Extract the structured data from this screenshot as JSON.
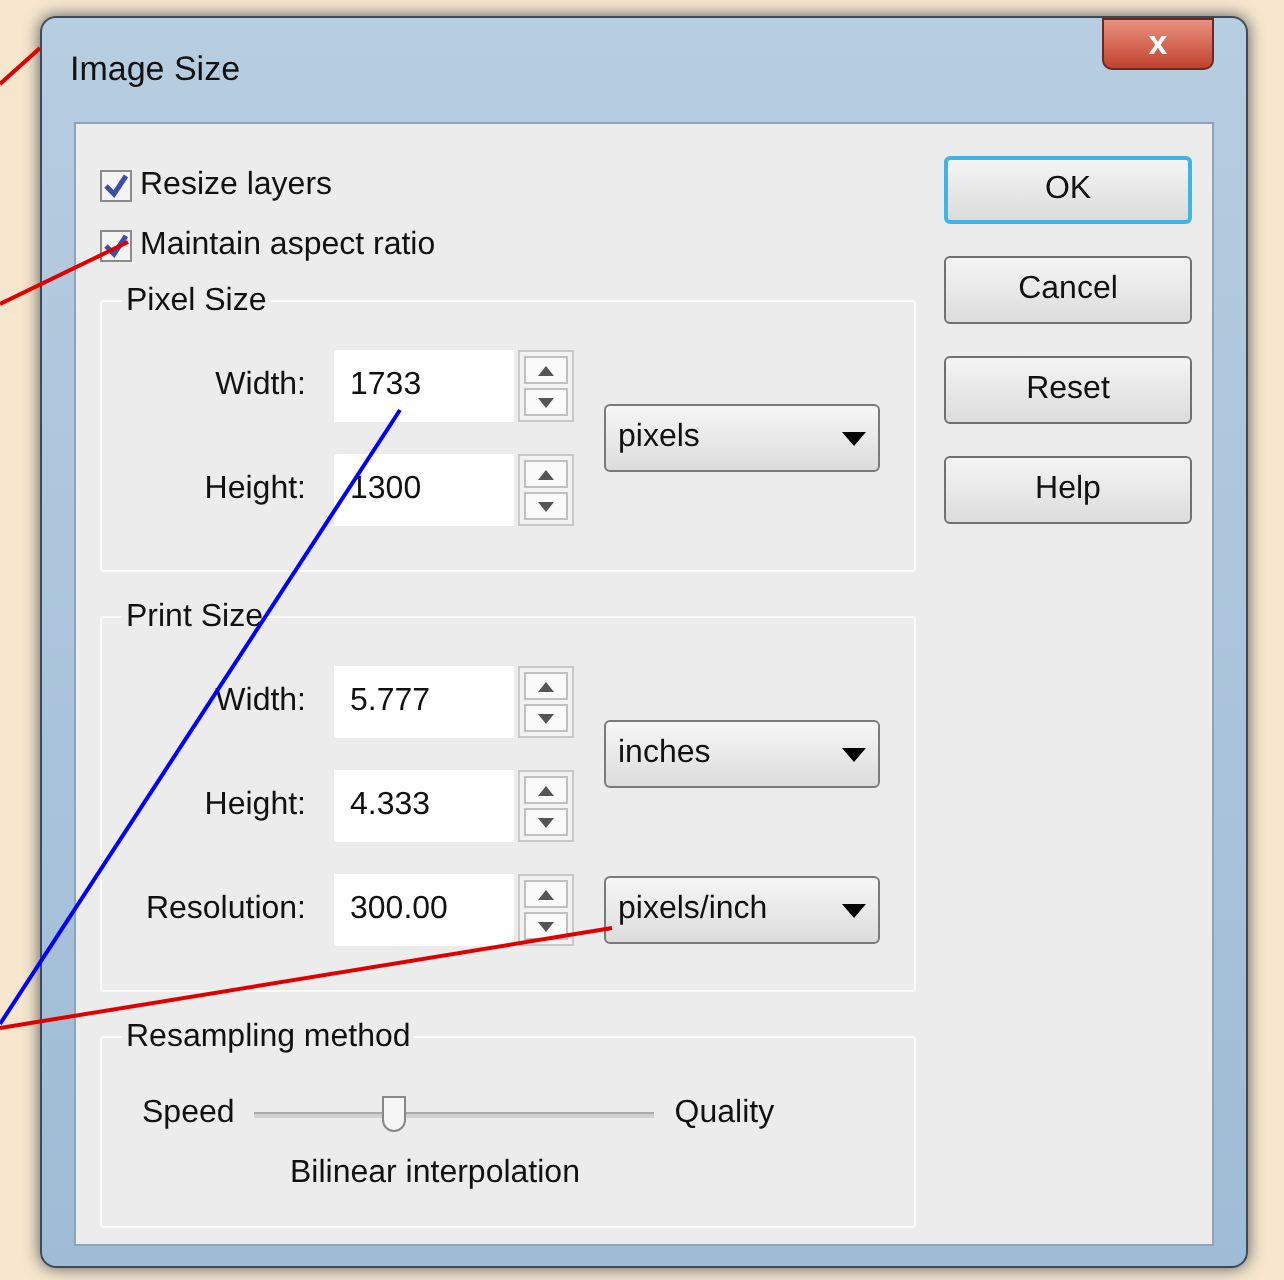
{
  "window": {
    "title": "Image Size",
    "close_label": "x"
  },
  "options": [
    {
      "label": "Resize layers",
      "checked": true
    },
    {
      "label": "Maintain aspect ratio",
      "checked": true
    }
  ],
  "groups": [
    {
      "title": "Pixel Size",
      "fields": [
        {
          "label": "Width:",
          "value": "1733"
        },
        {
          "label": "Height:",
          "value": "1300"
        }
      ],
      "unit": "pixels"
    },
    {
      "title": "Print Size",
      "fields": [
        {
          "label": "Width:",
          "value": "5.777"
        },
        {
          "label": "Height:",
          "value": "4.333"
        }
      ],
      "unit": "inches",
      "extra": {
        "label": "Resolution:",
        "value": "300.00",
        "unit": "pixels/inch"
      }
    }
  ],
  "resampling": {
    "title": "Resampling method",
    "left": "Speed",
    "right": "Quality",
    "level": 0.35,
    "method": "Bilinear interpolation"
  },
  "buttons": [
    {
      "label": "OK",
      "default": true
    },
    {
      "label": "Cancel",
      "default": false
    },
    {
      "label": "Reset",
      "default": false
    },
    {
      "label": "Help",
      "default": false
    }
  ]
}
